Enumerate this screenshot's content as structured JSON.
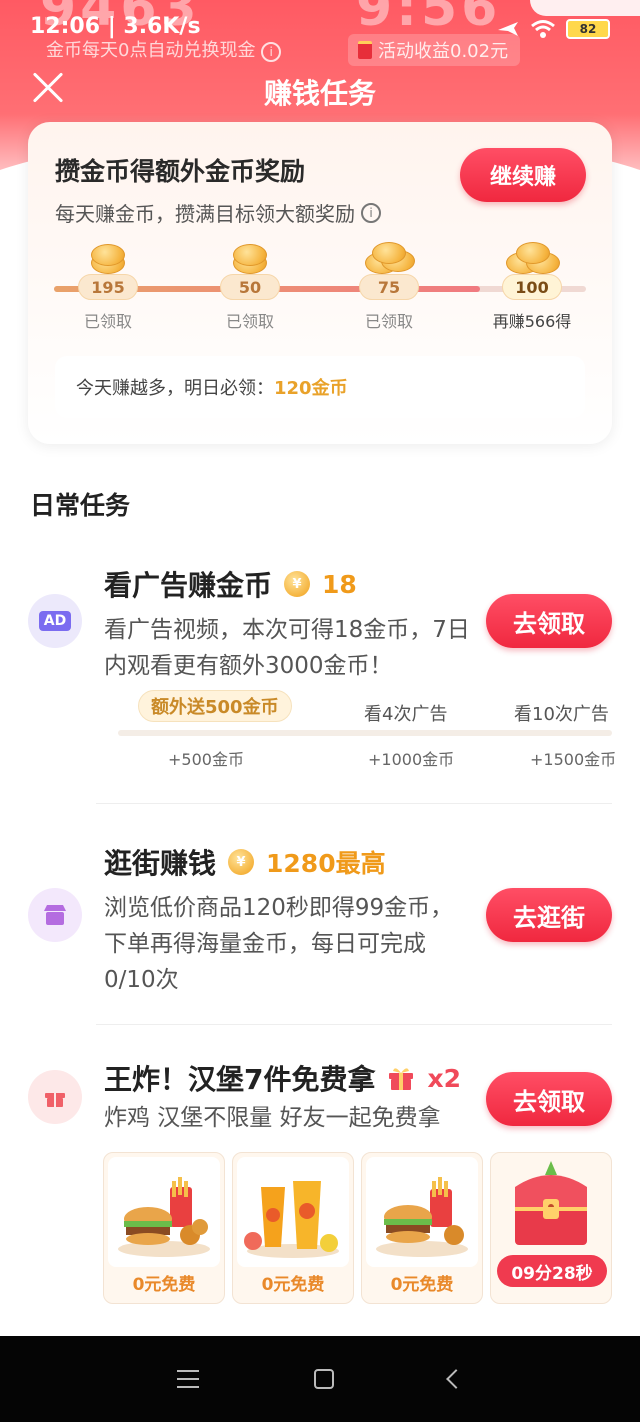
{
  "status_bar": {
    "time_speed": "12:06 | 3.6K/s",
    "battery": "82"
  },
  "header_bg": {
    "left": "9463",
    "right": "9:56"
  },
  "header": {
    "subtitle": "金币每天0点自动兑换现金",
    "chip": "活动收益0.02元",
    "title": "赚钱任务"
  },
  "bonus_card": {
    "title": "攒金币得额外金币奖励",
    "desc": "每天赚金币，攒满目标领大额奖励",
    "button": "继续赚",
    "progress": 0.8,
    "milestones": [
      {
        "amount": "195",
        "label": "已领取"
      },
      {
        "amount": "50",
        "label": "已领取"
      },
      {
        "amount": "75",
        "label": "已领取"
      },
      {
        "amount": "100",
        "label": "再赚566得"
      }
    ],
    "tomorrow_prefix": "今天赚越多，明日必领：",
    "tomorrow_value": "120金币"
  },
  "daily": {
    "section_title": "日常任务",
    "tasks": [
      {
        "title": "看广告赚金币",
        "reward": "18",
        "desc": "看广告视频，本次可得18金币，7日内观看更有额外3000金币！",
        "button": "去领取",
        "icon_text": "AD",
        "bubble": "额外送500金币",
        "steps": [
          {
            "label": "",
            "value": "+500金币"
          },
          {
            "label": "看4次广告",
            "value": "+1000金币"
          },
          {
            "label": "看10次广告",
            "value": "+1500金币"
          }
        ]
      },
      {
        "title": "逛街赚钱",
        "reward": "1280最高",
        "desc": "浏览低价商品120秒即得99金币，下单再得海量金币，每日可完成0/10次",
        "button": "去逛街"
      },
      {
        "title": "王炸！汉堡7件免费拿",
        "reward": "x2",
        "desc": "炸鸡 汉堡不限量 好友一起免费拿",
        "button": "去领取",
        "products": [
          {
            "price": "0元免费"
          },
          {
            "price": "0元免费"
          },
          {
            "price": "0元免费"
          }
        ],
        "timer": "09分28秒"
      }
    ]
  },
  "colors": {
    "accent": "#f0283f",
    "gold": "#f09a1a",
    "header": "#ff5a63"
  }
}
